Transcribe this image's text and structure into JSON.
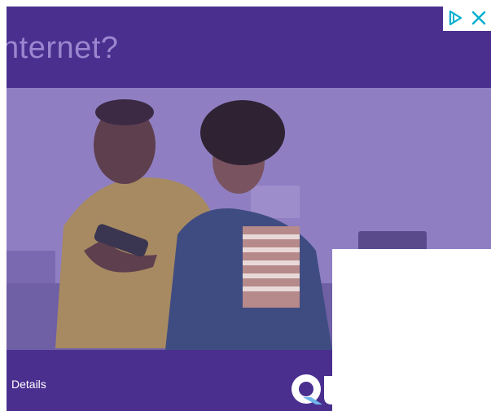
{
  "ad": {
    "headline": "nternet?",
    "details_label": "Details",
    "logo_text": "Qu",
    "colors": {
      "brand_purple": "#4a2f8f",
      "headline_text": "#9b86cf",
      "adchoices_cyan": "#00aecd"
    },
    "adchoices": {
      "info_icon": "adchoices-triangle-icon",
      "close_icon": "close-icon"
    }
  }
}
